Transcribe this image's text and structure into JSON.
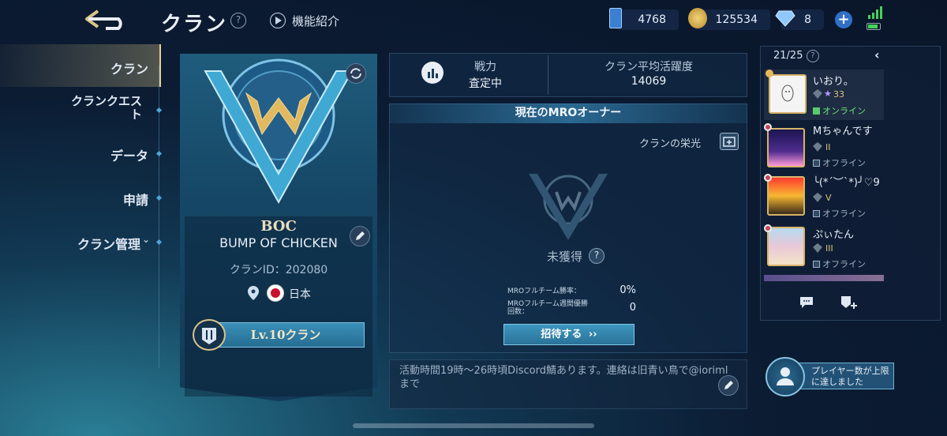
{
  "header": {
    "title": "クラン",
    "intro_label": "機能紹介"
  },
  "currencies": {
    "tickets": "4768",
    "gold": "125534",
    "diamonds": "8"
  },
  "sidebar": {
    "items": [
      {
        "label": "クラン"
      },
      {
        "label": "クランクエスト"
      },
      {
        "label": "データ"
      },
      {
        "label": "申請"
      },
      {
        "label": "クラン管理"
      }
    ]
  },
  "clan": {
    "tag": "BOC",
    "name": "BUMP OF CHICKEN",
    "id_text": "クランID：202080",
    "country": "日本",
    "level": "Lv.10クラン"
  },
  "stats": {
    "power_label": "戦力",
    "power_value": "査定中",
    "activity_label": "クラン平均活躍度",
    "activity_value": "14069"
  },
  "mro": {
    "header": "現在のMROオーナー",
    "honor_label": "クランの栄光",
    "status": "未獲得",
    "winrate_label": "MROフルチーム勝率：",
    "winrate_value": "0%",
    "weekly_label": "MROフルチーム週間優勝回数：",
    "weekly_value": "0",
    "invite_label": "招待する"
  },
  "notice": "活動時間19時〜26時頃Discord鯖あります。連絡は旧青い鳥で@ioriml まで",
  "members": {
    "count": "21/25",
    "list": [
      {
        "name": "いおり。",
        "rank": "33",
        "status": "オンライン",
        "online": true
      },
      {
        "name": "Mちゃんです",
        "rank": "II",
        "status": "オフライン",
        "online": false
      },
      {
        "name": "╰(*´︶`*)╯♡9",
        "rank": "V",
        "status": "オフライン",
        "online": false
      },
      {
        "name": "ぷぃたん",
        "rank": "III",
        "status": "オフライン",
        "online": false
      }
    ]
  },
  "full_notice": "プレイヤー数が上限に達しました"
}
